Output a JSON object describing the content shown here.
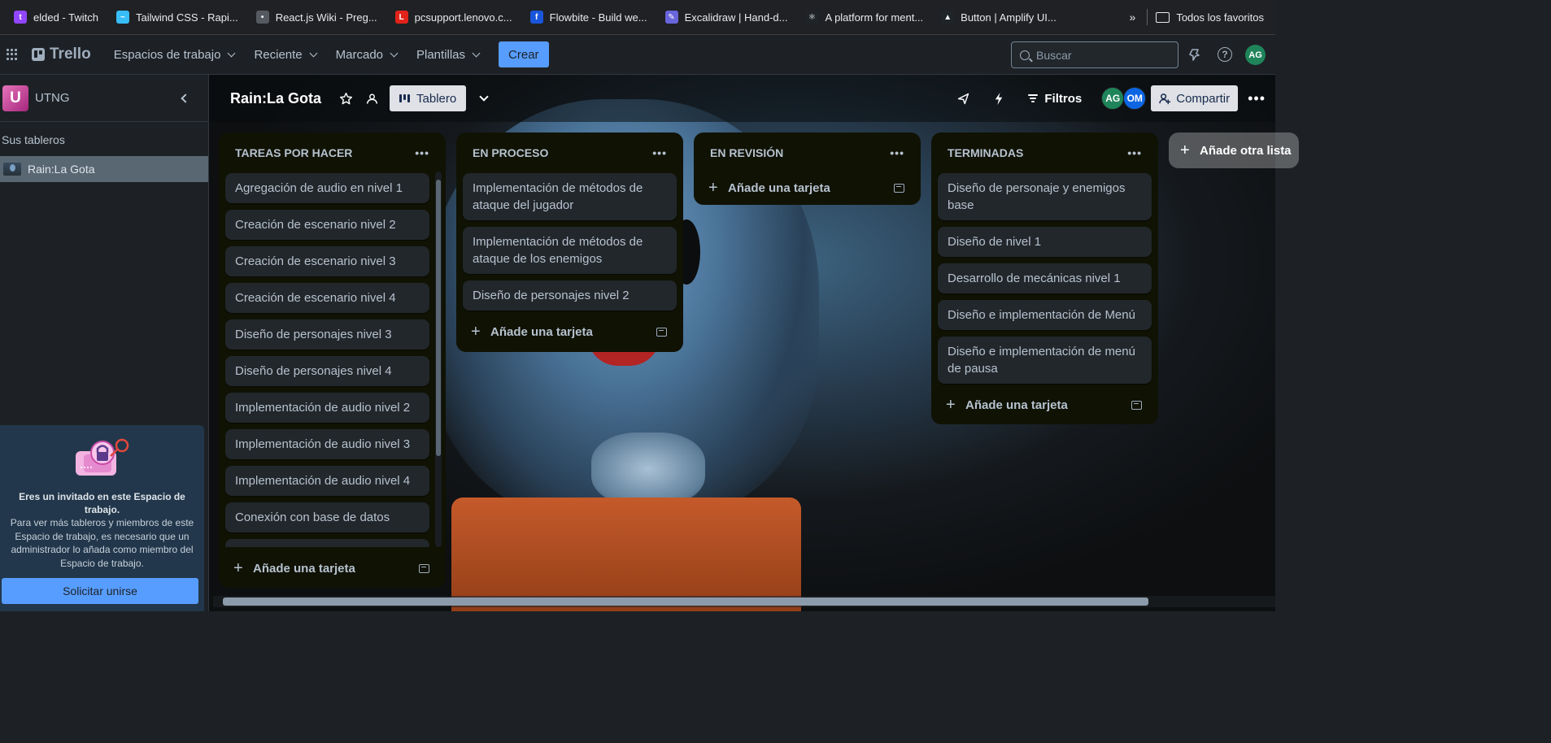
{
  "browser": {
    "bookmarks": [
      {
        "label": "elded - Twitch",
        "icon": "twitch-icon",
        "color": "#9146ff",
        "glyph": "t"
      },
      {
        "label": "Tailwind CSS - Rapi...",
        "icon": "tailwind-icon",
        "color": "#38bdf8",
        "glyph": "~"
      },
      {
        "label": "React.js Wiki - Preg...",
        "icon": "reactjs-wiki-icon",
        "color": "#555a60",
        "glyph": "•"
      },
      {
        "label": "pcsupport.lenovo.c...",
        "icon": "lenovo-icon",
        "color": "#e2231a",
        "glyph": "L"
      },
      {
        "label": "Flowbite - Build we...",
        "icon": "flowbite-icon",
        "color": "#1a56db",
        "glyph": "f"
      },
      {
        "label": "Excalidraw | Hand-d...",
        "icon": "excalidraw-icon",
        "color": "#6965db",
        "glyph": "✎"
      },
      {
        "label": "A platform for ment...",
        "icon": "react-icon",
        "color": "#1f2428",
        "glyph": "⚛"
      },
      {
        "label": "Button | Amplify UI...",
        "icon": "amplify-icon",
        "color": "#1f2428",
        "glyph": "▲"
      }
    ],
    "more": "»",
    "all_bookmarks": "Todos los favoritos"
  },
  "header": {
    "logo": "Trello",
    "nav": [
      "Espacios de trabajo",
      "Reciente",
      "Marcado",
      "Plantillas"
    ],
    "create": "Crear",
    "search_placeholder": "Buscar",
    "avatar": "AG",
    "avatar_color": "#1f845a"
  },
  "sidebar": {
    "workspace_initial": "U",
    "workspace_name": "UTNG",
    "section": "Sus tableros",
    "board": "Rain:La Gota",
    "invite_title": "Eres un invitado en este Espacio de trabajo.",
    "invite_text": "Para ver más tableros y miembros de este Espacio de trabajo, es necesario que un administrador lo añada como miembro del Espacio de trabajo.",
    "join": "Solicitar unirse"
  },
  "board": {
    "title": "Rain:La Gota",
    "view": "Tablero",
    "filters": "Filtros",
    "members": [
      {
        "initials": "AG",
        "color": "#1f845a"
      },
      {
        "initials": "OM",
        "color": "#0c66e4"
      }
    ],
    "share": "Compartir",
    "add_list": "Añade otra lista",
    "add_card": "Añade una tarjeta",
    "lists": [
      {
        "title": "TAREAS POR HACER",
        "cards": [
          "Agregación de audio en nivel 1",
          "Creación de escenario nivel 2",
          "Creación de escenario nivel 3",
          "Creación de escenario nivel 4",
          "Diseño de personajes nivel 3",
          "Diseño de personajes nivel 4",
          "Implementación de audio nivel 2",
          "Implementación de audio nivel 3",
          "Implementación de audio nivel 4",
          "Conexión con base de datos"
        ]
      },
      {
        "title": "EN PROCESO",
        "cards": [
          "Implementación de métodos de ataque del jugador",
          "Implementación de métodos de ataque de los enemigos",
          "Diseño de personajes nivel 2"
        ]
      },
      {
        "title": "EN REVISIÓN",
        "cards": []
      },
      {
        "title": "TERMINADAS",
        "cards": [
          "Diseño de personaje y enemigos base",
          "Diseño de nivel 1",
          "Desarrollo de mecánicas nivel 1",
          "Diseño e implementación de Menú",
          "Diseño e implementación de menú de pausa"
        ]
      }
    ]
  }
}
